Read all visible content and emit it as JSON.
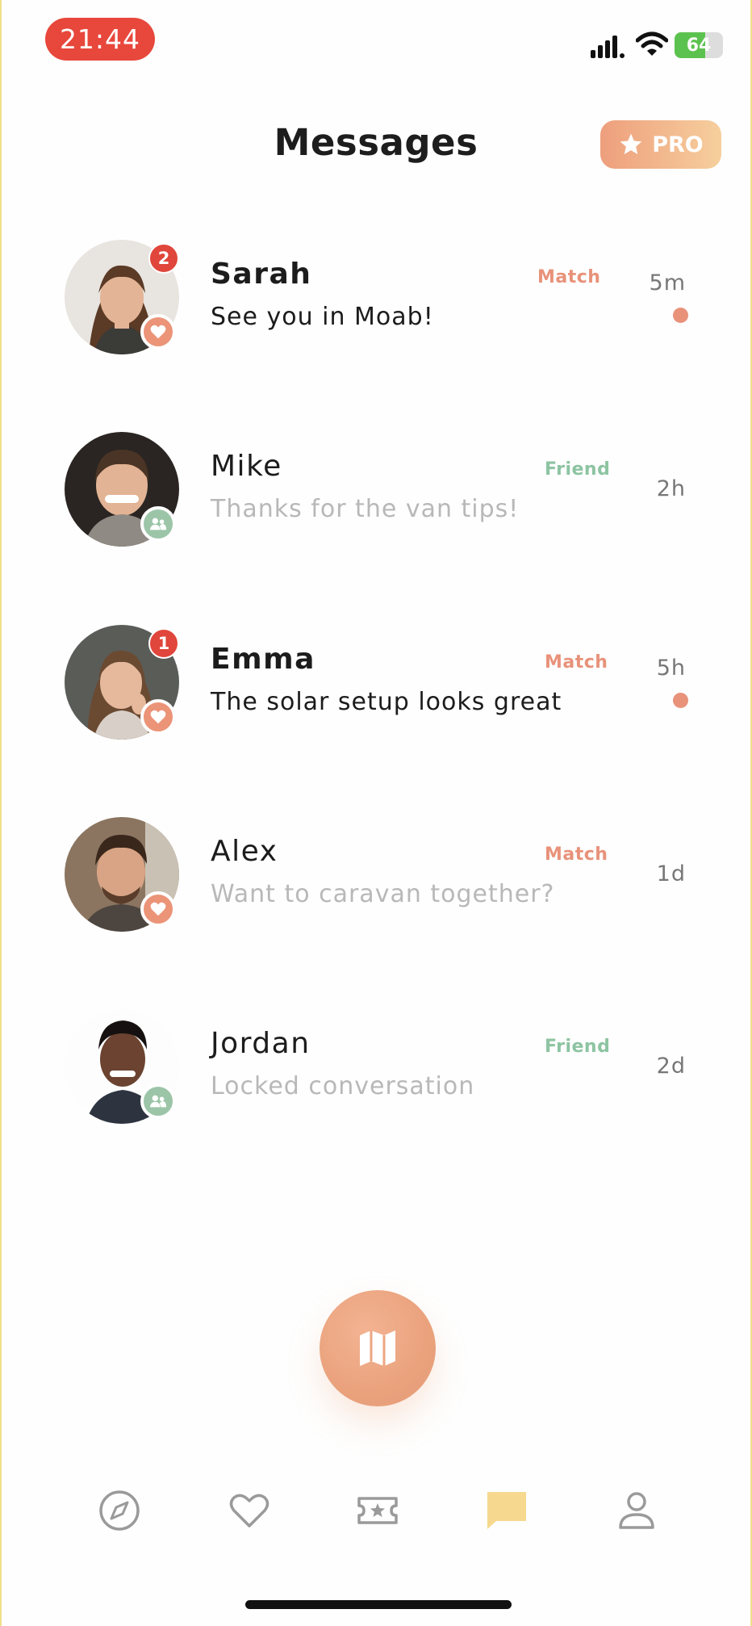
{
  "status_bar": {
    "time": "21:44",
    "battery": "64",
    "battery_level": 0.64
  },
  "header": {
    "title": "Messages",
    "pro_label": "PRO"
  },
  "conversations": [
    {
      "name": "Sarah",
      "preview": "See you in Moab!",
      "tag": "Match",
      "time": "5m",
      "unread_count": "2",
      "unread": true
    },
    {
      "name": "Mike",
      "preview": "Thanks for the van tips!",
      "tag": "Friend",
      "time": "2h",
      "unread": false
    },
    {
      "name": "Emma",
      "preview": "The solar setup looks great",
      "tag": "Match",
      "time": "5h",
      "unread_count": "1",
      "unread": true
    },
    {
      "name": "Alex",
      "preview": "Want to caravan together?",
      "tag": "Match",
      "time": "1d",
      "unread": false
    },
    {
      "name": "Jordan",
      "preview": "Locked conversation",
      "tag": "Friend",
      "time": "2d",
      "unread": false
    }
  ],
  "fab": {
    "icon": "map-icon"
  },
  "bottom_nav": {
    "items": [
      {
        "icon": "compass-icon",
        "active": false
      },
      {
        "icon": "heart-icon",
        "active": false
      },
      {
        "icon": "ticket-star-icon",
        "active": false
      },
      {
        "icon": "chat-bubble-icon",
        "active": true
      },
      {
        "icon": "profile-icon",
        "active": false
      }
    ]
  },
  "colors": {
    "accent": "#eb9478",
    "friend": "#9cc5a8",
    "badge_red": "#e0463b",
    "active_nav": "#f6d98e",
    "inactive_nav": "#9a9a9a"
  }
}
